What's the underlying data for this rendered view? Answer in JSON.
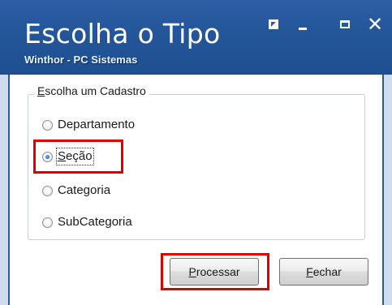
{
  "window": {
    "title": "Escolha o Tipo",
    "subtitle": "Winthor - PC Sistemas",
    "controls": {
      "restore_icon": "restore-icon",
      "minimize_icon": "minimize-icon",
      "maximize_icon": "maximize-icon",
      "close_glyph": "✕"
    }
  },
  "group": {
    "legend_first": "E",
    "legend_rest": "scolha um Cadastro",
    "options": [
      {
        "label": "Departamento",
        "selected": false
      },
      {
        "label_first": "S",
        "label_rest": "eção",
        "selected": true
      },
      {
        "label": "Categoria",
        "selected": false
      },
      {
        "label": "SubCategoria",
        "selected": false
      }
    ]
  },
  "buttons": {
    "processar_first": "P",
    "processar_rest": "rocessar",
    "fechar_first": "F",
    "fechar_rest": "echar"
  },
  "highlights": {
    "color": "#e00000",
    "items": [
      "secao-option",
      "processar-button"
    ]
  },
  "colors": {
    "titlebar": "#2a5a9e",
    "title_text": "#ffffff",
    "body_bg": "#ffffff",
    "frame_edge": "#cfdced"
  }
}
